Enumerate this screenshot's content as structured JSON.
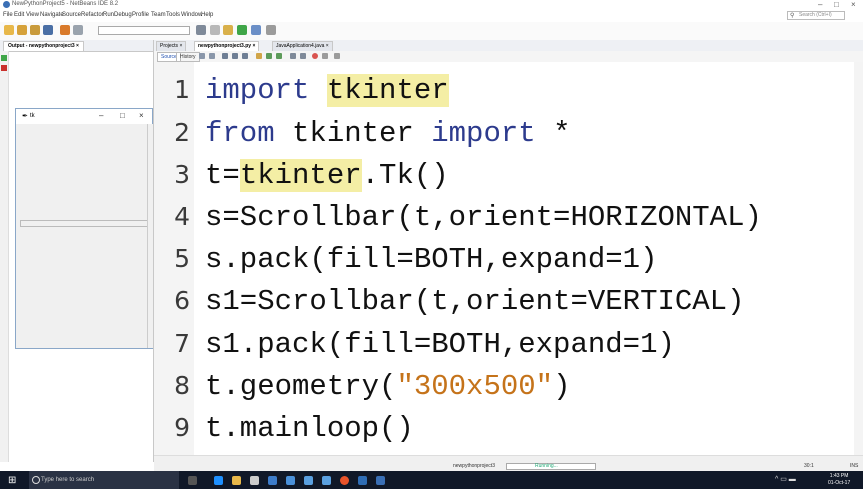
{
  "window": {
    "title": "NewPythonProject5 - NetBeans IDE 8.2",
    "controls": [
      "–",
      "□",
      "×"
    ]
  },
  "menu": {
    "items": [
      "File",
      "Edit",
      "View",
      "Navigate",
      "Source",
      "Refactor",
      "Run",
      "Debug",
      "Profile",
      "Team",
      "Tools",
      "Window",
      "Help"
    ]
  },
  "search": {
    "placeholder": "Search (Ctrl+I)"
  },
  "output_panel": {
    "tab_label": "Output - newpythonproject3 ×"
  },
  "tk_window": {
    "title": "tk",
    "controls": [
      "–",
      "□",
      "×"
    ]
  },
  "editor": {
    "tabs": [
      {
        "label": "Projects ×",
        "active": false
      },
      {
        "label": "newpythonproject3.py ×",
        "active": true
      },
      {
        "label": "JavaApplication4.java ×",
        "active": false
      }
    ],
    "source_label": "Source",
    "history_label": "History",
    "line_numbers": [
      "1",
      "2",
      "3",
      "4",
      "5",
      "6",
      "7",
      "8",
      "9"
    ],
    "code": {
      "l1": {
        "a": "import ",
        "b": "tkinter"
      },
      "l2": {
        "a": "from ",
        "b": "tkinter ",
        "c": "import",
        "d": " *"
      },
      "l3": {
        "a": "t=",
        "b": "tkinter",
        "c": ".Tk()"
      },
      "l4": "s=Scrollbar(t,orient=HORIZONTAL)",
      "l5": "s.pack(fill=BOTH,expand=1)",
      "l6": "s1=Scrollbar(t,orient=VERTICAL)",
      "l7": "s1.pack(fill=BOTH,expand=1)",
      "l8": {
        "a": "t.geometry(",
        "b": "\"300x500\"",
        "c": ")"
      },
      "l9": "t.mainloop()"
    }
  },
  "statusbar": {
    "project": "newpythonproject3",
    "progress_label": "Running...",
    "position": "30:1",
    "mode": "INS"
  },
  "taskbar": {
    "search_placeholder": "Type here to search",
    "time": "1:43 PM",
    "date": "01-Oct-17"
  },
  "colors": {
    "keyword": "#2d3b8d",
    "string": "#c5731a",
    "highlight": "#f4eea5",
    "taskbar": "#101828"
  }
}
